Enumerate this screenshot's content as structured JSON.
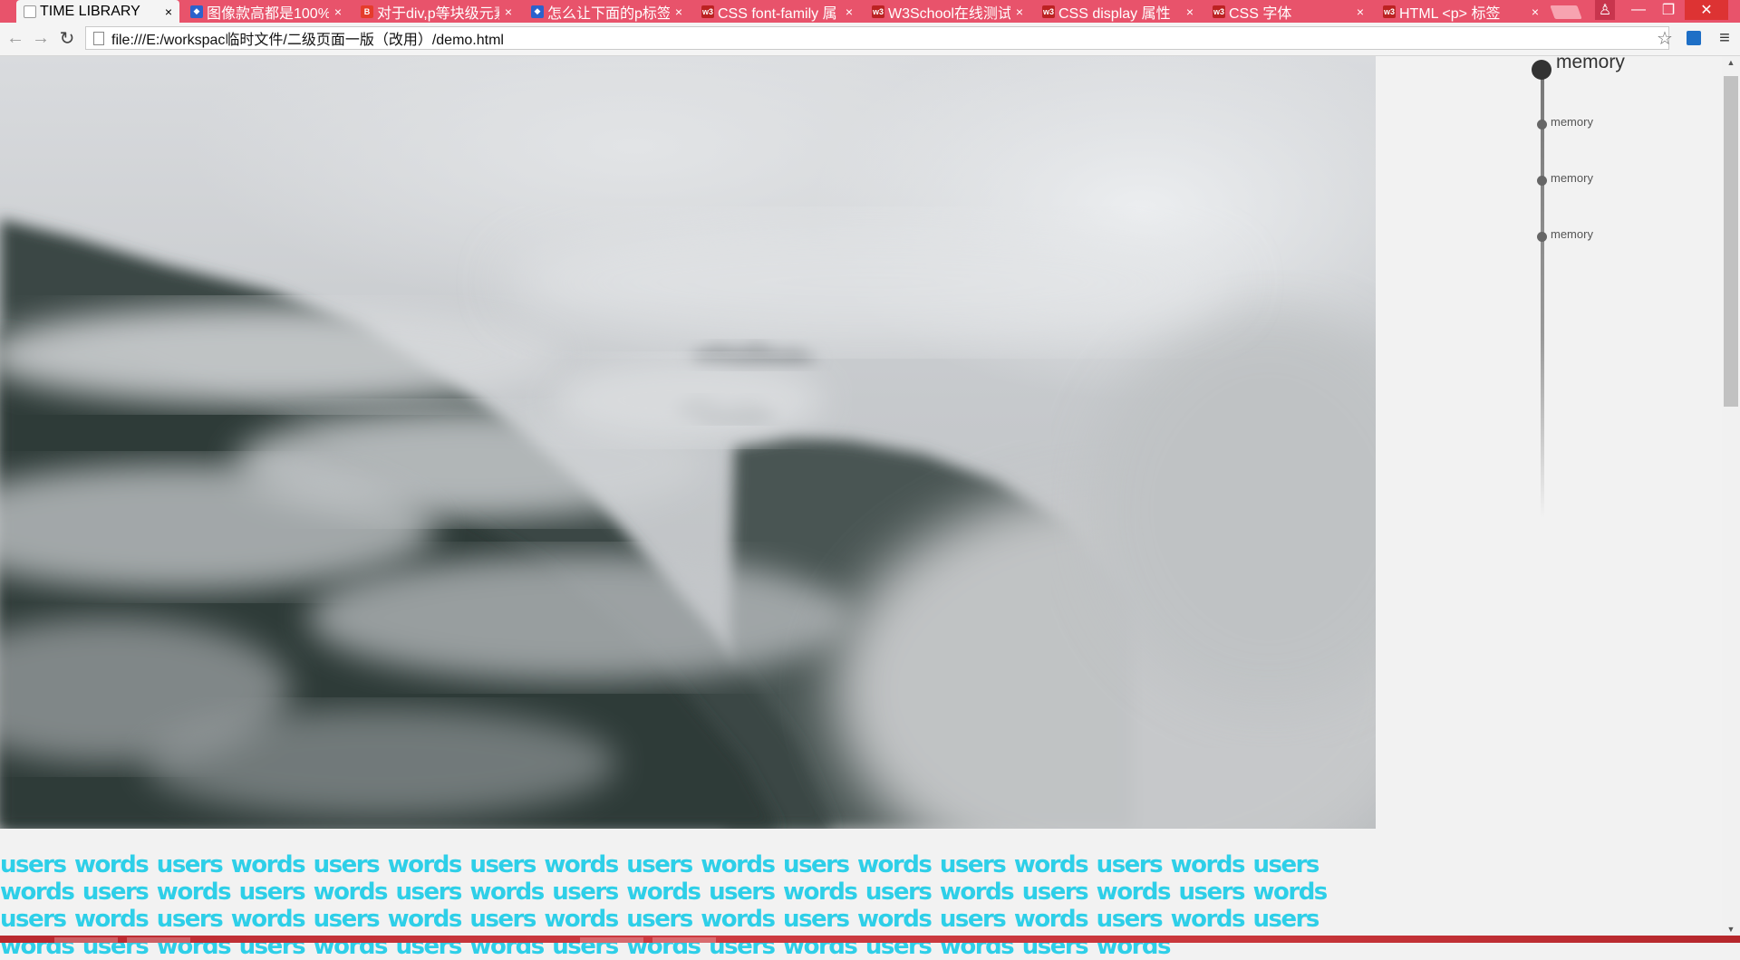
{
  "browser": {
    "tabs": [
      {
        "title": "TIME LIBRARY",
        "icon": "page-icon",
        "active": true
      },
      {
        "title": "图像款高都是100%",
        "icon": "paw-icon"
      },
      {
        "title": "对于div,p等块级元素",
        "icon": "b-icon"
      },
      {
        "title": "怎么让下面的p标签",
        "icon": "paw-icon"
      },
      {
        "title": "CSS font-family 属",
        "icon": "w3-icon"
      },
      {
        "title": "W3School在线测试",
        "icon": "w3-icon"
      },
      {
        "title": "CSS display 属性",
        "icon": "w3-icon"
      },
      {
        "title": "CSS 字体",
        "icon": "w3-icon"
      },
      {
        "title": "HTML <p> 标签",
        "icon": "w3-icon"
      }
    ],
    "tab_close_glyph": "×",
    "fav_w3": "w3",
    "fav_b": "B",
    "window": {
      "user": "♙",
      "minimize": "—",
      "maximize": "❐",
      "close": "✕"
    },
    "nav": {
      "back": "←",
      "forward": "→",
      "reload": "↻"
    },
    "address": "file:///E:/workspac临时文件/二级页面一版（改用）/demo.html",
    "star": "☆",
    "menu": "≡"
  },
  "page": {
    "user_words": "users words users words users words users words users words users words users words users words users words users words users words users words users words users words users words users words users words users words users words users words users words users words users words users words users words users words users words users words users words users words users words users words users words",
    "timeline": {
      "primary": "memory",
      "items": [
        "memory",
        "memory",
        "memory"
      ]
    }
  },
  "colors": {
    "tabstrip": "#e8536b",
    "text_accent": "#2ecfe8",
    "timeline_dot": "#333333"
  }
}
